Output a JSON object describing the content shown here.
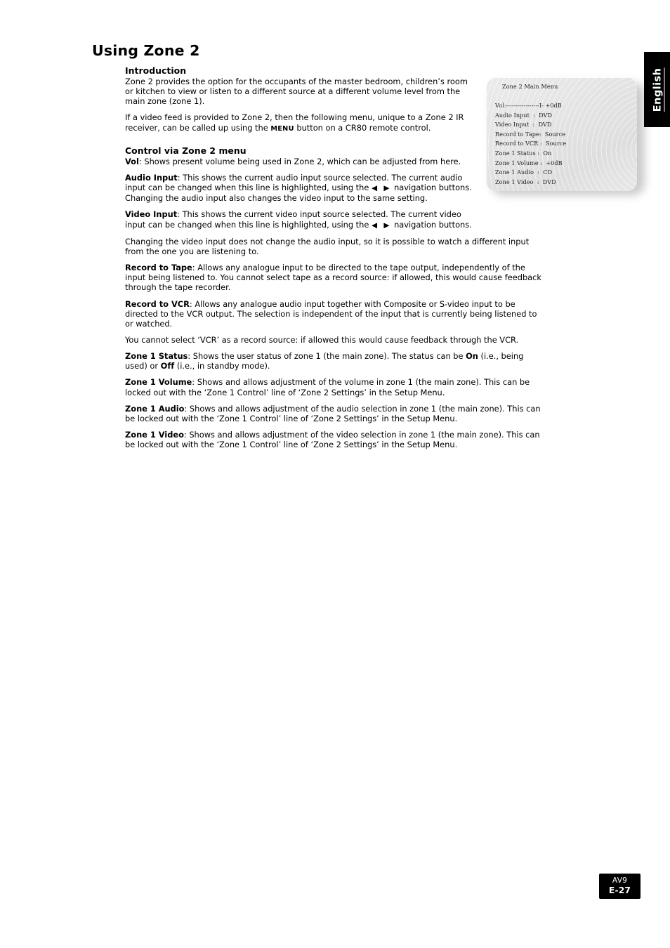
{
  "page": {
    "title": "Using Zone 2",
    "language_tab": "English",
    "footer": {
      "model": "AV9",
      "page_number": "E-27"
    }
  },
  "sections": {
    "introduction": {
      "heading": "Introduction",
      "paragraph_1": "Zone 2 provides the option for the occupants of the master bedroom, children’s room or kitchen to view or listen to a different source at a different volume level from the main zone (zone 1).",
      "paragraph_2_before": "If a video feed is provided to Zone 2, then the following menu, unique to a Zone 2 IR receiver, can be called up using the ",
      "paragraph_2_menu": "MENU",
      "paragraph_2_after": " button on a CR80 remote control."
    },
    "control": {
      "heading": "Control via Zone 2 menu",
      "items": {
        "vol": {
          "term": "Vol",
          "text": ": Shows present volume being used in Zone 2, which can be adjusted from here."
        },
        "audio_input": {
          "term": "Audio Input",
          "text_before": ": This shows the current audio input source selected. The current audio input can be changed when this line is highlighted, using the ",
          "arrows": "◀  ▶",
          "text_after": " navigation buttons. Changing the audio input also changes the video input to the same setting."
        },
        "video_input": {
          "term": "Video Input",
          "text_before": ": This shows the current video input source selected. The current video input can be changed when this line is highlighted, using the ",
          "arrows": "◀  ▶",
          "text_after": " navigation buttons."
        },
        "video_note": "Changing the video input does not change the audio input, so it is possible to watch a different input from the one you are listening to.",
        "record_to_tape": {
          "term": "Record to Tape",
          "text": ": Allows any analogue input to be directed to the tape output, independently of the input being listened to. You cannot select tape as a record source: if allowed, this would cause feedback through the tape recorder."
        },
        "record_to_vcr": {
          "term": "Record to VCR",
          "text": ": Allows any analogue audio input together with Composite or S-video input to be directed to the VCR output. The selection is independent of the input that is currently being listened to or watched."
        },
        "vcr_note": "You cannot select ‘VCR’ as a record source: if allowed this would cause feedback through the VCR.",
        "zone1_status": {
          "term": "Zone 1 Status",
          "text_before": ": Shows the user status of zone 1 (the main zone). The status can be ",
          "on": "On",
          "text_middle": " (i.e., being used) or ",
          "off": "Off",
          "text_after": " (i.e., in standby mode)."
        },
        "zone1_volume": {
          "term": "Zone 1 Volume",
          "text": ": Shows and allows adjustment of the volume in zone 1 (the main zone). This can be locked out with the ‘Zone 1 Control’ line of ‘Zone 2 Settings’ in the Setup Menu."
        },
        "zone1_audio": {
          "term": "Zone 1 Audio",
          "text": ": Shows and allows adjustment of the audio selection in zone 1 (the main zone). This can be locked out with the ‘Zone 1 Control’ line of ‘Zone 2 Settings’ in the Setup Menu."
        },
        "zone1_video": {
          "term": "Zone 1 Video",
          "text": ": Shows and allows adjustment of the video selection in zone 1 (the main zone). This can be locked out with the ‘Zone 1 Control’ line of ‘Zone 2 Settings’ in the Setup Menu."
        }
      }
    }
  },
  "osd_menu": {
    "title": "Zone 2 Main Menu",
    "rows": [
      "Vol:-----------------I- +0dB",
      "Audio Input  :  DVD",
      "Video Input  :  DVD",
      "Record to Tape:  Source",
      "Record to VCR :  Source",
      "Zone 1 Status :  On",
      "Zone 1 Volume :  +0dB",
      "Zone 1 Audio  :  CD",
      "Zone 1 Video  :  DVD"
    ]
  }
}
